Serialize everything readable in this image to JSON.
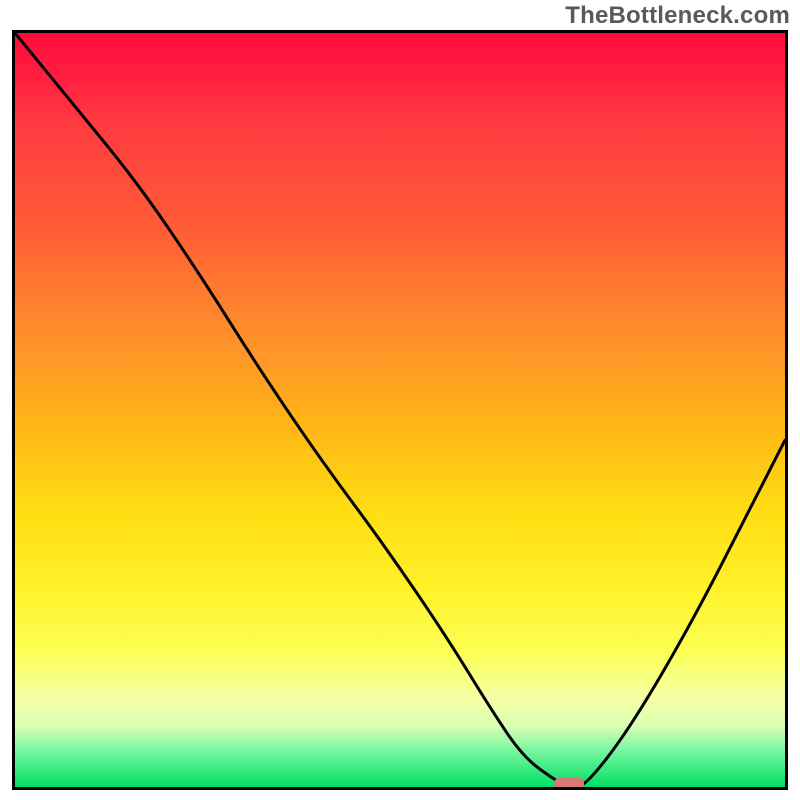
{
  "watermark": "TheBottleneck.com",
  "chart_data": {
    "type": "line",
    "title": "",
    "xlabel": "",
    "ylabel": "",
    "xlim": [
      0,
      100
    ],
    "ylim": [
      0,
      100
    ],
    "series": [
      {
        "name": "bottleneck-curve",
        "x": [
          0,
          8,
          16,
          24,
          32,
          40,
          48,
          56,
          62,
          66,
          70,
          72,
          74,
          80,
          88,
          96,
          100
        ],
        "y": [
          100,
          90,
          80,
          68,
          55,
          43,
          32,
          20,
          10,
          4,
          1,
          0,
          0,
          8,
          22,
          38,
          46
        ]
      }
    ],
    "minimum_marker": {
      "x": 72,
      "y": 0
    },
    "background_gradient_stops": [
      {
        "pos": 0.0,
        "color": "#ff0a3a"
      },
      {
        "pos": 0.25,
        "color": "#ff5a36"
      },
      {
        "pos": 0.52,
        "color": "#ffb518"
      },
      {
        "pos": 0.74,
        "color": "#fff22a"
      },
      {
        "pos": 0.92,
        "color": "#d8ffb4"
      },
      {
        "pos": 1.0,
        "color": "#00e066"
      }
    ]
  }
}
